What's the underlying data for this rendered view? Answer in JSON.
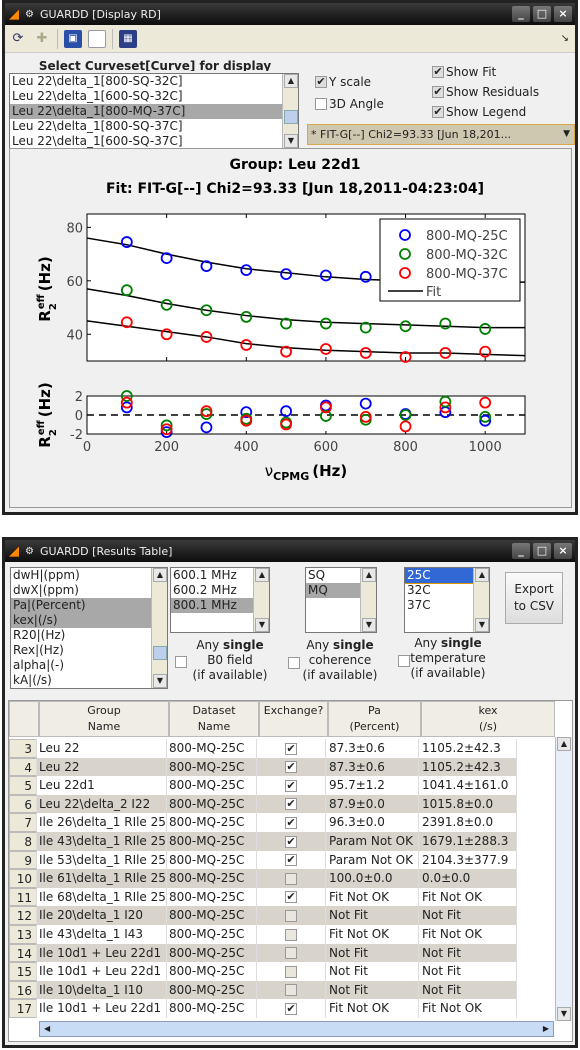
{
  "window1": {
    "title": "GUARDD [Display RD]",
    "toolbar_icons": [
      "refresh-icon",
      "select-icon",
      "save-icon",
      "new-page-icon",
      "export-icon"
    ],
    "select_label": "Select Curveset[Curve] for display",
    "curve_list": [
      "Leu 22\\delta_1[800-SQ-32C]",
      "Leu 22\\delta_1[600-SQ-32C]",
      "Leu 22\\delta_1[800-MQ-37C]",
      "Leu 22\\delta_1[800-SQ-37C]",
      "Leu 22\\delta_1[600-SQ-37C]"
    ],
    "selected_curve_index": 2,
    "options": {
      "y_scale": {
        "label": "Y scale",
        "checked": true
      },
      "angle_3d": {
        "label": "3D Angle",
        "checked": false
      },
      "show_fit": {
        "label": "Show Fit",
        "checked": true
      },
      "show_residuals": {
        "label": "Show Residuals",
        "checked": true
      },
      "show_legend": {
        "label": "Show Legend",
        "checked": true
      }
    },
    "fit_dropdown": "* FIT-G[--] Chi2=93.33 [Jun 18,201..."
  },
  "chart_data": [
    {
      "type": "scatter",
      "title": "Group: Leu 22d1",
      "subtitle": "Fit: FIT-G[--] Chi2=93.33 [Jun 18,2011-04:23:04]",
      "ylabel": "R2eff (Hz)",
      "ylabel_main": "R",
      "ylabel_sup": "eff",
      "ylabel_sub": "2",
      "ylabel_unit": "(Hz)",
      "xlim": [
        0,
        1100
      ],
      "ylim": [
        30,
        85
      ],
      "yticks": [
        40,
        60,
        80
      ],
      "legend": "top-right",
      "grid": false,
      "series": [
        {
          "name": "800-MQ-25C",
          "color": "#0000ff",
          "x": [
            100,
            200,
            300,
            400,
            500,
            600,
            700
          ],
          "y": [
            74.5,
            68.5,
            65.5,
            64,
            62.5,
            62,
            61.5
          ],
          "fit_x": [
            0,
            100,
            200,
            300,
            400,
            500,
            600,
            700,
            800,
            900,
            1000,
            1100
          ],
          "fit_y": [
            76,
            73.5,
            70,
            67,
            64.5,
            63,
            61.5,
            60.5,
            60,
            59.5,
            59.5,
            59.5
          ]
        },
        {
          "name": "800-MQ-32C",
          "color": "#008000",
          "x": [
            100,
            200,
            300,
            400,
            500,
            600,
            700,
            800,
            900,
            1000
          ],
          "y": [
            56.5,
            51,
            49,
            46.5,
            44,
            44,
            42.5,
            43,
            44,
            42
          ],
          "fit_x": [
            0,
            100,
            200,
            300,
            400,
            500,
            600,
            700,
            800,
            900,
            1000,
            1100
          ],
          "fit_y": [
            57,
            54.5,
            51.5,
            49,
            47,
            45.5,
            44.5,
            44,
            43.5,
            43,
            42.5,
            42.5
          ]
        },
        {
          "name": "800-MQ-37C",
          "color": "#ff0000",
          "x": [
            100,
            200,
            300,
            400,
            500,
            600,
            700,
            800,
            900,
            1000
          ],
          "y": [
            44.5,
            40,
            39,
            36,
            33.5,
            34.5,
            33,
            31.5,
            33,
            33.5
          ],
          "fit_x": [
            0,
            100,
            200,
            300,
            400,
            500,
            600,
            700,
            800,
            900,
            1000,
            1100
          ],
          "fit_y": [
            45,
            43,
            41,
            39,
            36.5,
            35,
            34,
            33.5,
            33,
            33,
            32.5,
            32
          ]
        }
      ],
      "fit_legend": "Fit"
    },
    {
      "type": "scatter",
      "xlabel": "νCPMG (Hz)",
      "xlabel_main": "ν",
      "xlabel_sub": "CPMG",
      "xlabel_unit": "(Hz)",
      "ylabel_unit": "(Hz)",
      "xlim": [
        0,
        1100
      ],
      "ylim": [
        -2,
        2
      ],
      "xticks": [
        0,
        200,
        400,
        600,
        800,
        1000
      ],
      "yticks": [
        -2,
        0,
        2
      ],
      "zero_line": "dashed",
      "series": [
        {
          "color": "#0000ff",
          "x": [
            100,
            200,
            300,
            400,
            500,
            600,
            700,
            800,
            900,
            1000
          ],
          "y": [
            0.8,
            -1.8,
            -1.3,
            0.3,
            0.4,
            1.0,
            1.2,
            0.1,
            0.3,
            -0.6
          ]
        },
        {
          "color": "#008000",
          "x": [
            100,
            200,
            300,
            400,
            500,
            600,
            700,
            800,
            900,
            1000
          ],
          "y": [
            2.0,
            -1.1,
            0.1,
            -0.4,
            -0.8,
            -0.1,
            -0.5,
            0.0,
            1.4,
            -0.2
          ]
        },
        {
          "color": "#ff0000",
          "x": [
            100,
            200,
            300,
            400,
            500,
            600,
            700,
            800,
            900,
            1000
          ],
          "y": [
            1.3,
            -1.5,
            0.4,
            -0.6,
            -1.0,
            0.8,
            -0.2,
            -1.2,
            0.8,
            1.3
          ]
        }
      ]
    }
  ],
  "window2": {
    "title": "GUARDD [Results Table]",
    "param_list": [
      "dwH|(ppm)",
      "dwX|(ppm)",
      "Pa|(Percent)",
      "kex|(/s)",
      "R20|(Hz)",
      "Rex|(Hz)",
      "alpha|(-)",
      "kA|(/s)"
    ],
    "param_selected": [
      2,
      3
    ],
    "field_list": [
      "600.1 MHz",
      "600.2 MHz",
      "800.1 MHz"
    ],
    "field_selected": 2,
    "coherence_list": [
      "SQ",
      "MQ"
    ],
    "coherence_selected": 1,
    "temp_list": [
      "25C",
      "32C",
      "37C"
    ],
    "temp_selected": 0,
    "export_button": [
      "Export",
      "to CSV"
    ],
    "any_single": [
      "Any ",
      "single"
    ],
    "field_option": [
      "B0 field",
      "(if available)"
    ],
    "coherence_option": [
      "coherence",
      "(if available)"
    ],
    "temp_option": [
      "temperature",
      "(if available)"
    ],
    "columns": [
      [
        "Group",
        "Name"
      ],
      [
        "Dataset",
        "Name"
      ],
      [
        "Exchange?",
        ""
      ],
      [
        "Pa",
        "(Percent)"
      ],
      [
        "kex",
        "(/s)"
      ]
    ],
    "rows": [
      {
        "n": "3",
        "group": "Leu 22",
        "dataset": "800-MQ-25C",
        "exchange": true,
        "pa": "87.3±0.6",
        "kex": "1105.2±42.3"
      },
      {
        "n": "4",
        "group": "Leu 22",
        "dataset": "800-MQ-25C",
        "exchange": true,
        "pa": "87.3±0.6",
        "kex": "1105.2±42.3"
      },
      {
        "n": "5",
        "group": "Leu 22d1",
        "dataset": "800-MQ-25C",
        "exchange": true,
        "pa": "95.7±1.2",
        "kex": "1041.4±161.0"
      },
      {
        "n": "6",
        "group": "Leu 22\\delta_2 I22",
        "dataset": "800-MQ-25C",
        "exchange": true,
        "pa": "87.9±0.0",
        "kex": "1015.8±0.0"
      },
      {
        "n": "7",
        "group": "Ile 26\\delta_1 RIle 25C",
        "dataset": "800-MQ-25C",
        "exchange": true,
        "pa": "96.3±0.0",
        "kex": "2391.8±0.0"
      },
      {
        "n": "8",
        "group": "Ile 43\\delta_1 RIle 25C",
        "dataset": "800-MQ-25C",
        "exchange": true,
        "pa": "Param Not OK",
        "kex": "1679.1±288.3"
      },
      {
        "n": "9",
        "group": "Ile 53\\delta_1 RIle 25C",
        "dataset": "800-MQ-25C",
        "exchange": true,
        "pa": "Param Not OK",
        "kex": "2104.3±377.9"
      },
      {
        "n": "10",
        "group": "Ile 61\\delta_1 RIle 25C",
        "dataset": "800-MQ-25C",
        "exchange": false,
        "pa": "100.0±0.0",
        "kex": "0.0±0.0"
      },
      {
        "n": "11",
        "group": "Ile 68\\delta_1 RIle 25C",
        "dataset": "800-MQ-25C",
        "exchange": true,
        "pa": "Fit Not OK",
        "kex": "Fit Not OK"
      },
      {
        "n": "12",
        "group": "Ile 20\\delta_1 I20",
        "dataset": "800-MQ-25C",
        "exchange": false,
        "pa": "Not Fit",
        "kex": "Not Fit"
      },
      {
        "n": "13",
        "group": "Ile 43\\delta_1 I43",
        "dataset": "800-MQ-25C",
        "exchange": false,
        "pa": "Fit Not OK",
        "kex": "Fit Not OK"
      },
      {
        "n": "14",
        "group": "Ile 10d1 + Leu 22d1",
        "dataset": "800-MQ-25C",
        "exchange": false,
        "pa": "Not Fit",
        "kex": "Not Fit"
      },
      {
        "n": "15",
        "group": "Ile 10d1 + Leu 22d1",
        "dataset": "800-MQ-25C",
        "exchange": false,
        "pa": "Not Fit",
        "kex": "Not Fit"
      },
      {
        "n": "16",
        "group": "Ile 10\\delta_1 I10",
        "dataset": "800-MQ-25C",
        "exchange": false,
        "pa": "Not Fit",
        "kex": "Not Fit"
      },
      {
        "n": "17",
        "group": "Ile 10d1 + Leu 22d1",
        "dataset": "800-MQ-25C",
        "exchange": true,
        "pa": "Fit Not OK",
        "kex": "Fit Not OK"
      }
    ]
  }
}
